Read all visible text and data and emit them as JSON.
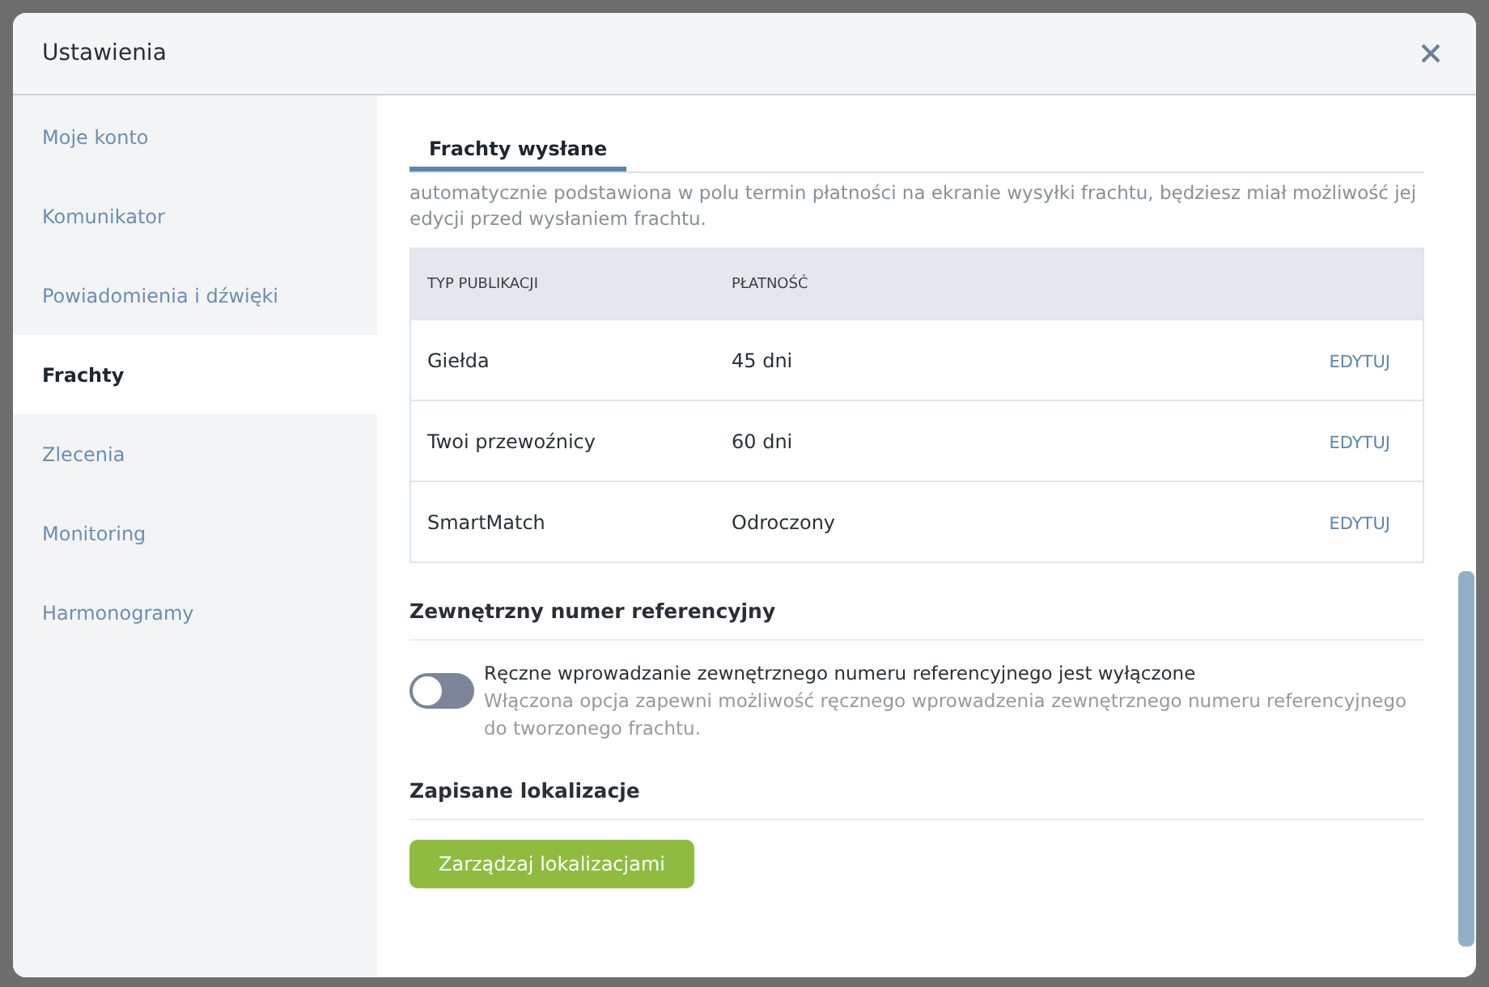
{
  "window": {
    "title": "Ustawienia"
  },
  "sidebar": {
    "items": [
      {
        "label": "Moje konto",
        "selected": false
      },
      {
        "label": "Komunikator",
        "selected": false
      },
      {
        "label": "Powiadomienia i dźwięki",
        "selected": false
      },
      {
        "label": "Frachty",
        "selected": true
      },
      {
        "label": "Zlecenia",
        "selected": false
      },
      {
        "label": "Monitoring",
        "selected": false
      },
      {
        "label": "Harmonogramy",
        "selected": false
      }
    ]
  },
  "tabs": [
    {
      "label": "Frachty wysłane",
      "selected": true
    }
  ],
  "description": "automatycznie podstawiona w polu termin płatności na ekranie wysyłki frachtu, będziesz miał możliwość jej edycji przed wysłaniem frachtu.",
  "table": {
    "columns": [
      "TYP PUBLIKACJI",
      "PŁATNOŚĆ"
    ],
    "rows": [
      {
        "type": "Giełda",
        "payment": "45 dni",
        "action": "EDYTUJ"
      },
      {
        "type": "Twoi przewoźnicy",
        "payment": "60 dni",
        "action": "EDYTUJ"
      },
      {
        "type": "SmartMatch",
        "payment": "Odroczony",
        "action": "EDYTUJ"
      }
    ]
  },
  "reference": {
    "heading": "Zewnętrzny numer referencyjny",
    "toggle": {
      "on": false,
      "label": "Ręczne wprowadzanie zewnętrznego numeru referencyjnego jest wyłączone",
      "hint": "Włączona opcja zapewni możliwość ręcznego wprowadzenia zewnętrznego numeru referencyjnego do tworzonego frachtu."
    }
  },
  "locations": {
    "heading": "Zapisane lokalizacje",
    "button": "Zarządzaj lokalizacjami"
  }
}
